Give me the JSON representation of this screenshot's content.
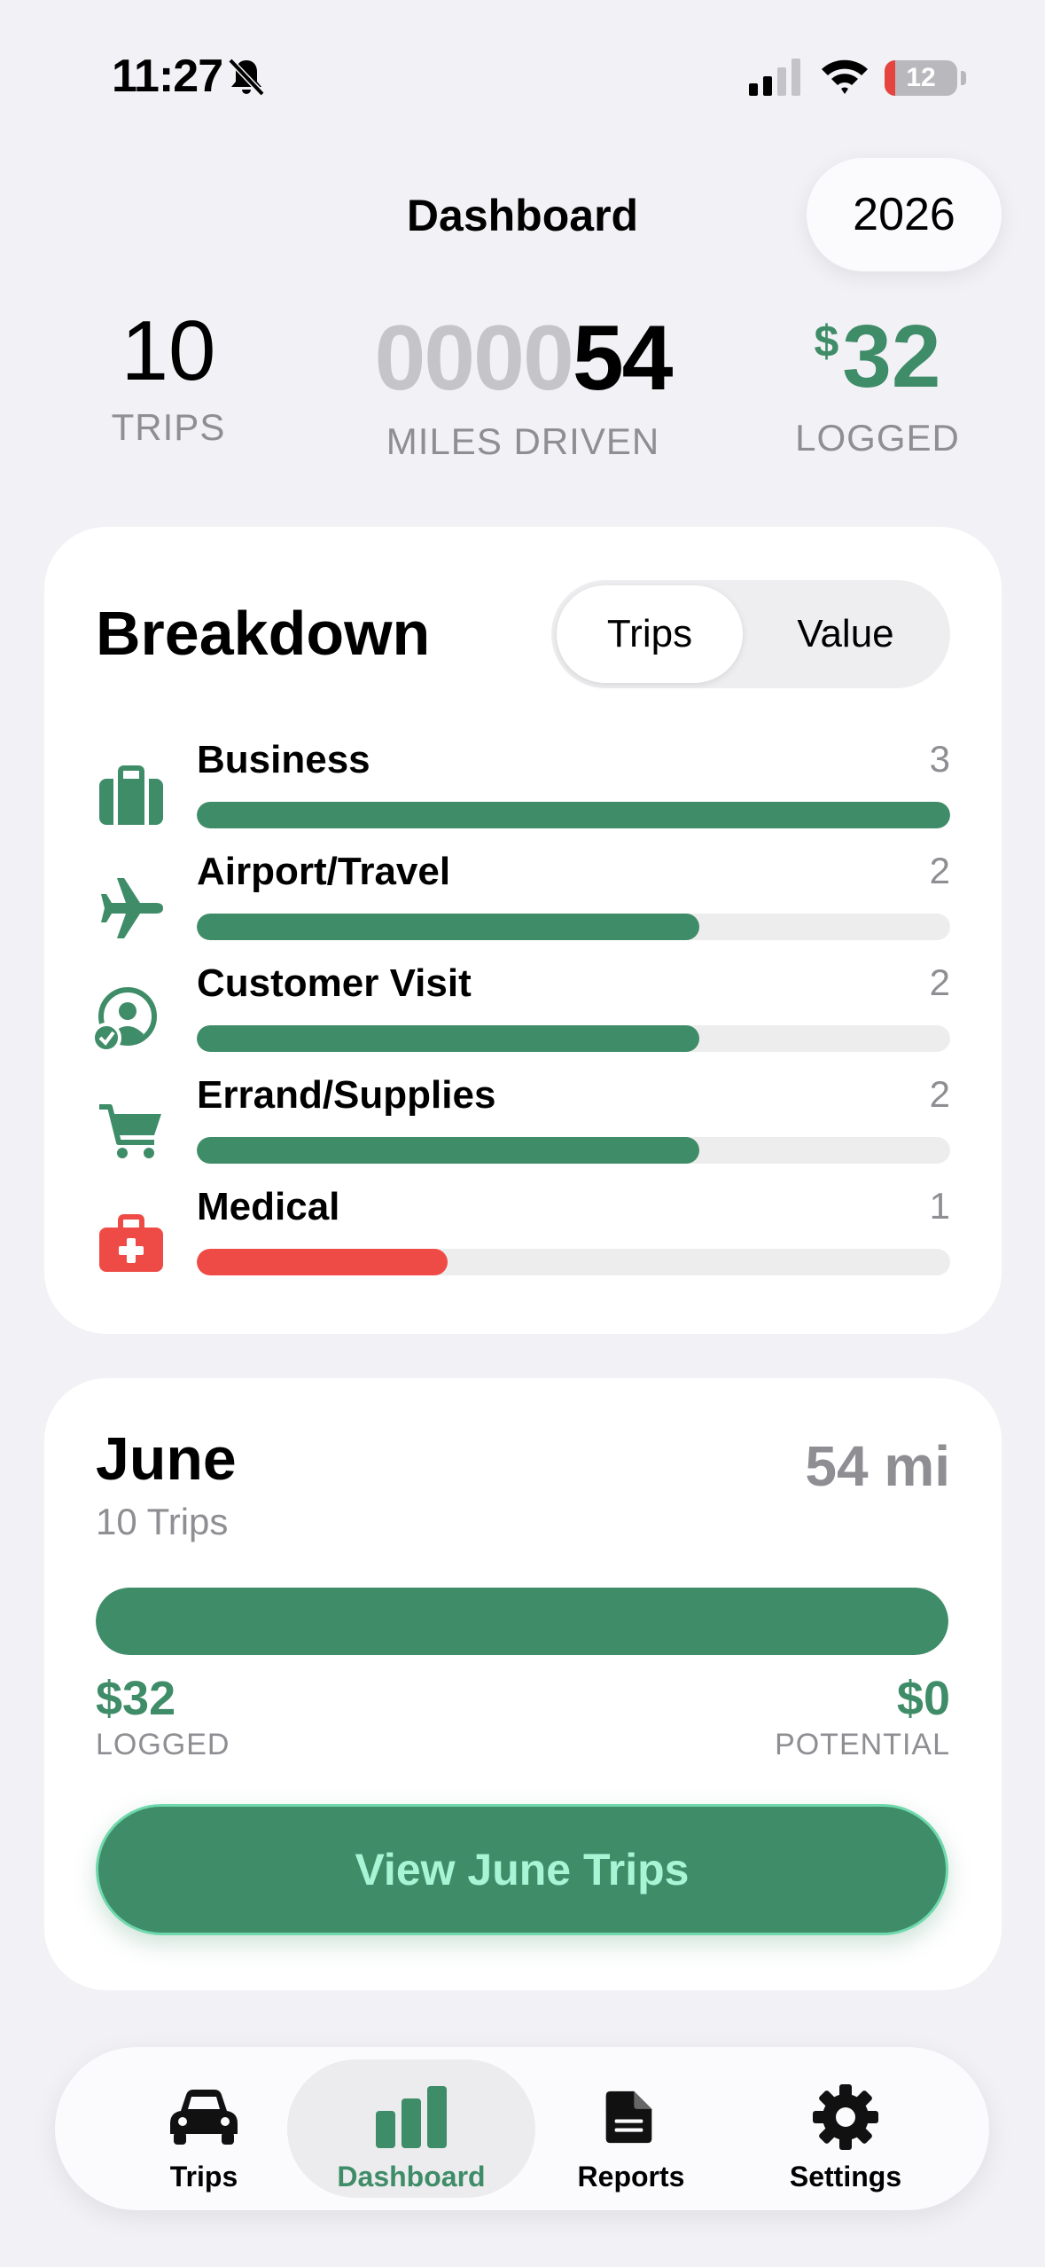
{
  "status_bar": {
    "time": "11:27",
    "battery": "12"
  },
  "header": {
    "title": "Dashboard",
    "year": "2026"
  },
  "stats": {
    "trips_value": "10",
    "trips_label": "TRIPS",
    "miles_zeros": "0000",
    "miles_value": "54",
    "miles_label": "MILES DRIVEN",
    "logged_currency": "$",
    "logged_value": "32",
    "logged_label": "LOGGED"
  },
  "breakdown": {
    "title": "Breakdown",
    "toggle": {
      "options": [
        "Trips",
        "Value"
      ],
      "selected": "Trips"
    },
    "categories": [
      {
        "name": "Business",
        "count": "3",
        "fraction": 1.0,
        "icon": "briefcase-icon",
        "color": "#3f8c68"
      },
      {
        "name": "Airport/Travel",
        "count": "2",
        "fraction": 0.667,
        "icon": "airplane-icon",
        "color": "#3f8c68"
      },
      {
        "name": "Customer Visit",
        "count": "2",
        "fraction": 0.667,
        "icon": "person-check-icon",
        "color": "#3f8c68"
      },
      {
        "name": "Errand/Supplies",
        "count": "2",
        "fraction": 0.667,
        "icon": "cart-icon",
        "color": "#3f8c68"
      },
      {
        "name": "Medical",
        "count": "1",
        "fraction": 0.333,
        "icon": "medical-kit-icon",
        "color": "#ef4b46"
      }
    ]
  },
  "month": {
    "title": "June",
    "trips": "10 Trips",
    "miles": "54 mi",
    "progress_fraction": 1.0,
    "logged_amount": "$32",
    "logged_label": "LOGGED",
    "potential_amount": "$0",
    "potential_label": "POTENTIAL",
    "button_label": "View June Trips"
  },
  "tab_bar": {
    "active": "Dashboard",
    "tabs": [
      {
        "label": "Trips",
        "icon": "car-icon"
      },
      {
        "label": "Dashboard",
        "icon": "bar-chart-icon"
      },
      {
        "label": "Reports",
        "icon": "document-icon"
      },
      {
        "label": "Settings",
        "icon": "gear-icon"
      }
    ]
  },
  "colors": {
    "accent": "#3f8c68",
    "danger": "#ef4b46",
    "muted": "#8e8e93",
    "background": "#f2f2f6"
  }
}
